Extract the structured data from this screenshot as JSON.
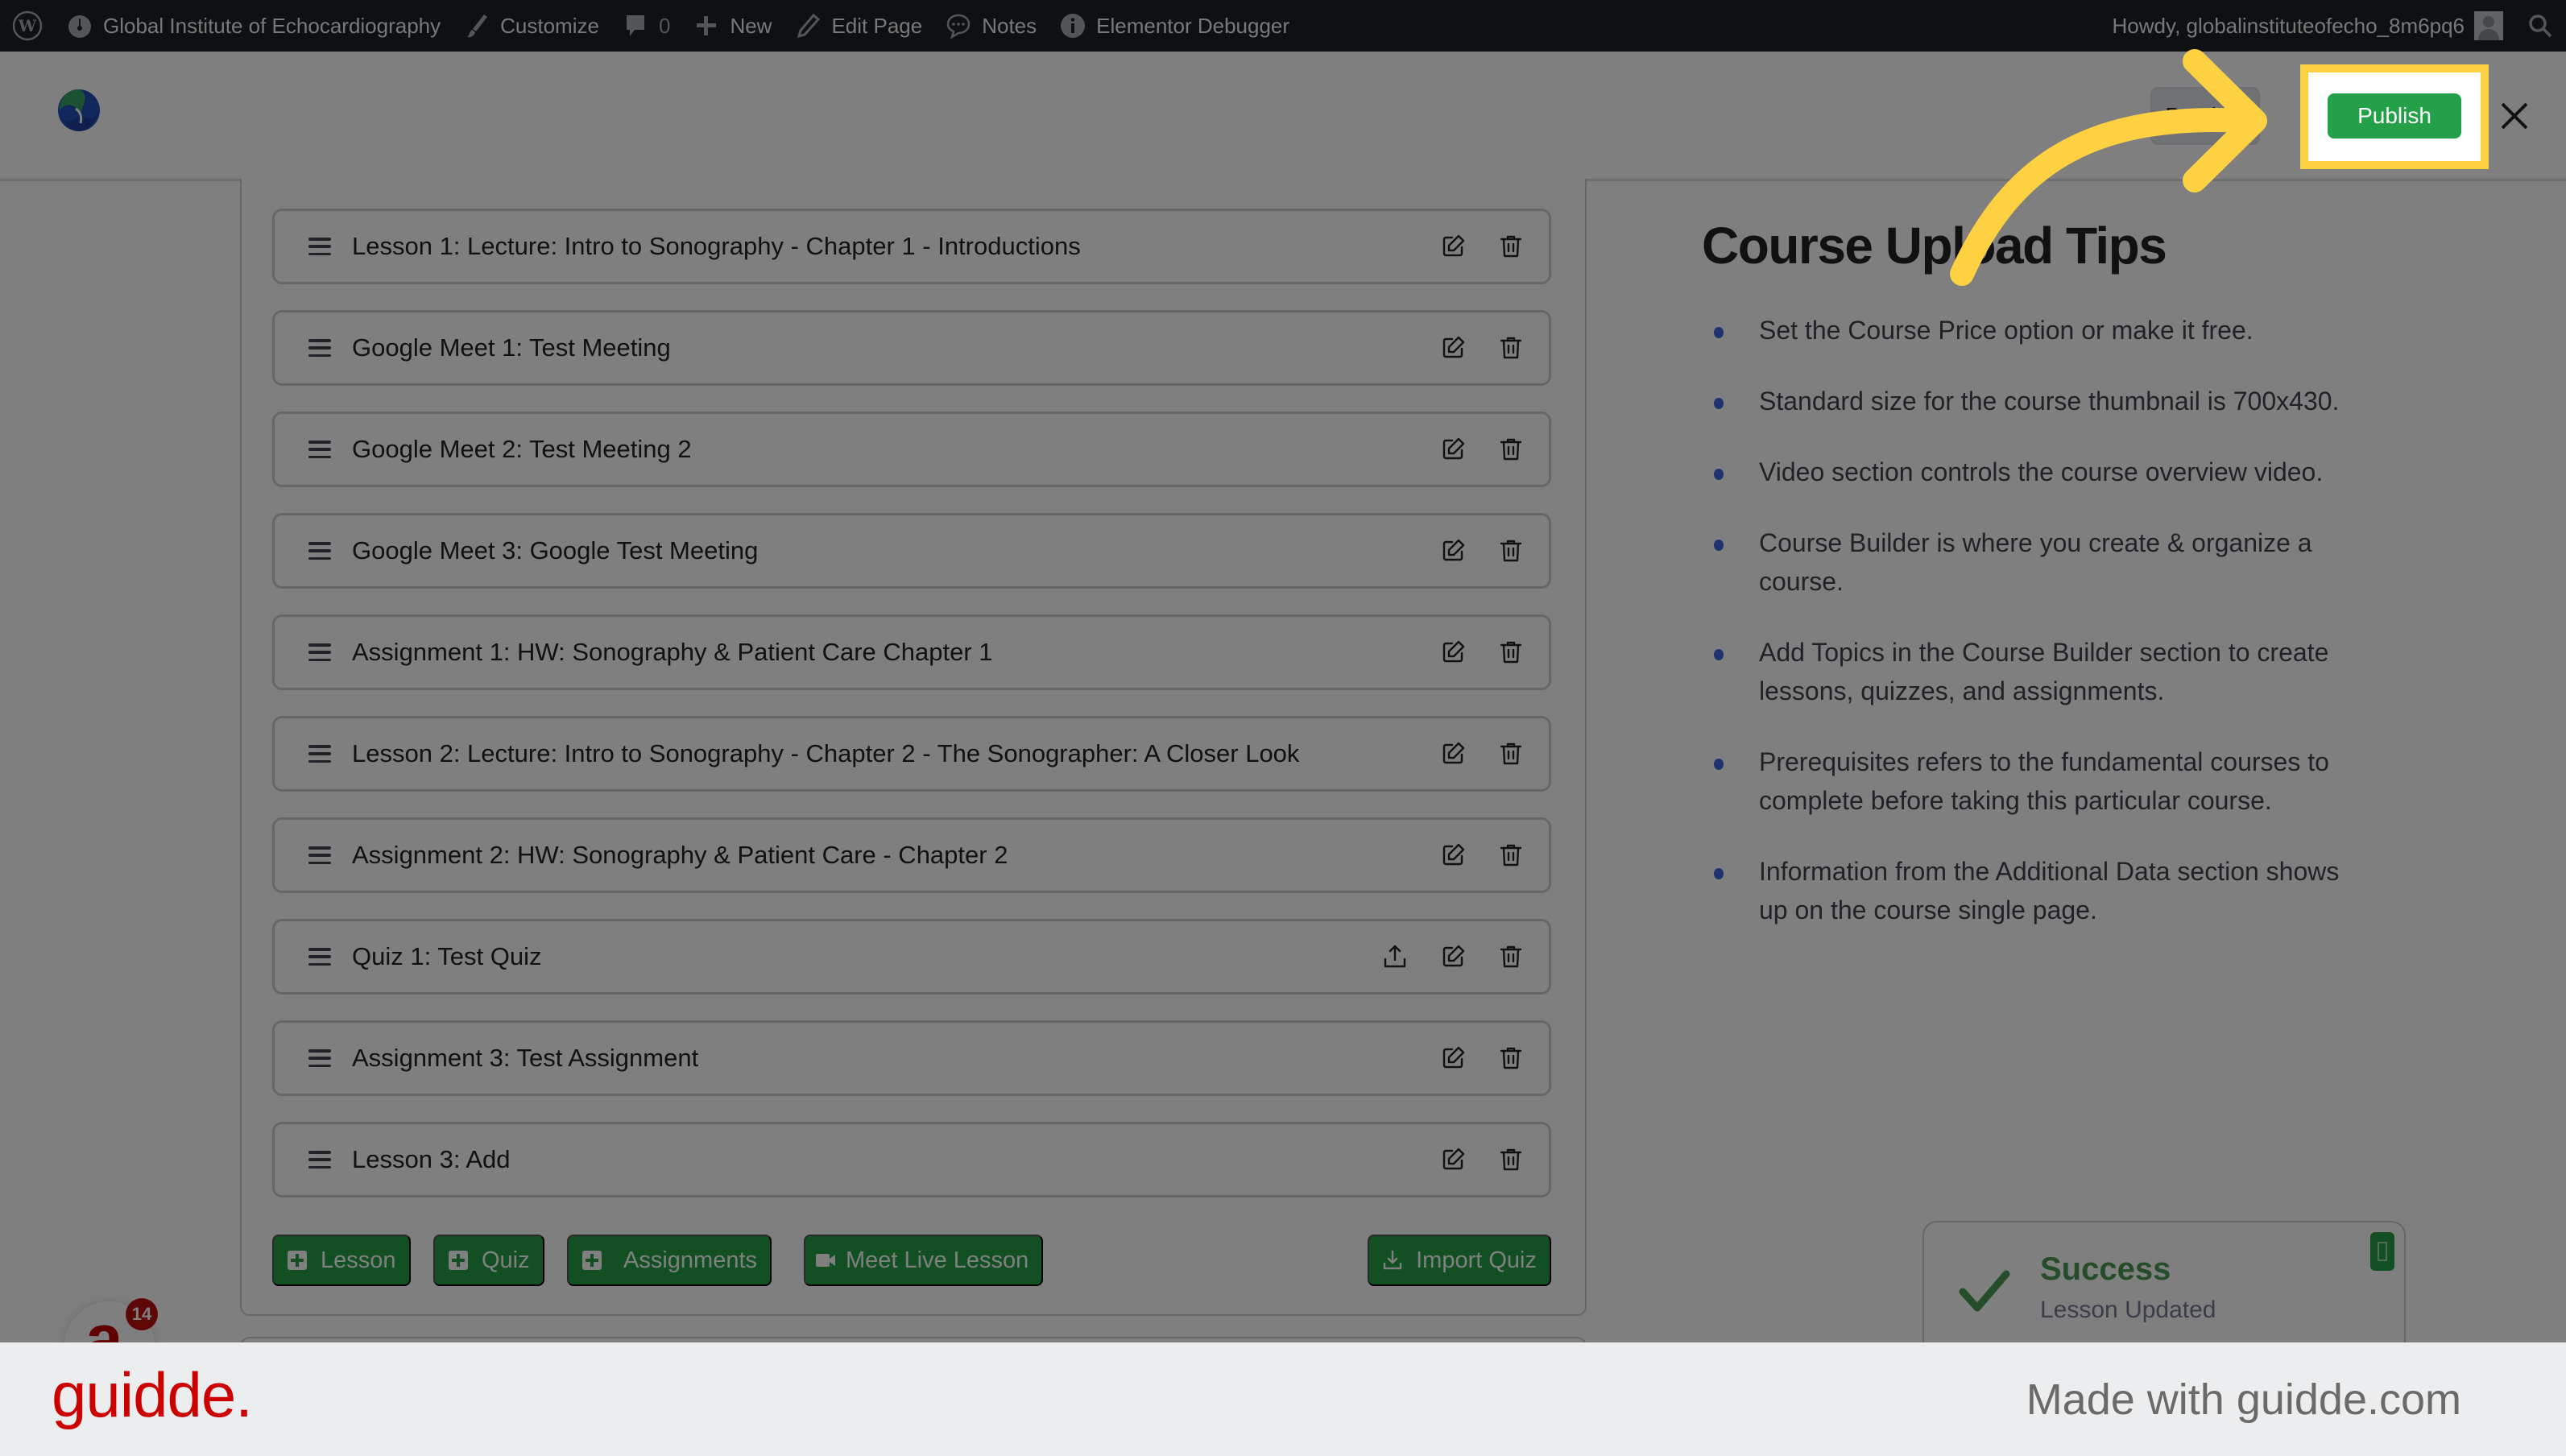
{
  "admin_bar": {
    "site_name": "Global Institute of Echocardiography",
    "customize": "Customize",
    "comments_count": "0",
    "new": "New",
    "edit_page": "Edit Page",
    "notes": "Notes",
    "elementor_debugger": "Elementor Debugger",
    "howdy": "Howdy, globalinstituteofecho_8m6pq6"
  },
  "header": {
    "preview_label": "Preview",
    "publish_label": "Publish"
  },
  "course_builder": {
    "items": [
      {
        "title": "Lesson 1: Lecture: Intro to Sonography - Chapter 1 - Introductions",
        "has_export": false
      },
      {
        "title": "Google Meet 1: Test Meeting",
        "has_export": false
      },
      {
        "title": "Google Meet 2: Test Meeting 2",
        "has_export": false
      },
      {
        "title": "Google Meet 3: Google Test Meeting",
        "has_export": false
      },
      {
        "title": "Assignment 1: HW: Sonography & Patient Care Chapter 1",
        "has_export": false
      },
      {
        "title": "Lesson 2: Lecture: Intro to Sonography - Chapter 2 - The Sonographer: A Closer Look",
        "has_export": false
      },
      {
        "title": "Assignment 2: HW: Sonography & Patient Care - Chapter 2",
        "has_export": false
      },
      {
        "title": "Quiz 1: Test Quiz",
        "has_export": true
      },
      {
        "title": "Assignment 3: Test Assignment",
        "has_export": false
      },
      {
        "title": "Lesson 3: Add",
        "has_export": false
      }
    ],
    "buttons": {
      "lesson": "Lesson",
      "quiz": "Quiz",
      "assignments": "Assignments",
      "meet_live_lesson": "Meet Live Lesson",
      "import_quiz": "Import Quiz"
    }
  },
  "tips": {
    "title": "Course Upload Tips",
    "items": [
      "Set the Course Price option or make it free.",
      "Standard size for the course thumbnail is 700x430.",
      "Video section controls the course overview video.",
      "Course Builder is where you create & organize a course.",
      "Add Topics in the Course Builder section to create lessons, quizzes, and assignments.",
      "Prerequisites refers to the fundamental courses to complete before taking this particular course.",
      "Information from the Additional Data section shows up on the course single page."
    ]
  },
  "toast": {
    "title": "Success",
    "message": "Lesson Updated"
  },
  "floating_badge": {
    "letter": "a",
    "count": "14"
  },
  "footer": {
    "logo": "guidde.",
    "made_with": "Made with guidde.com"
  },
  "colors": {
    "accent_green": "#24a148",
    "highlight_yellow": "#fdd141",
    "guidde_red": "#cc0000",
    "tip_bullet": "#3e64de"
  }
}
